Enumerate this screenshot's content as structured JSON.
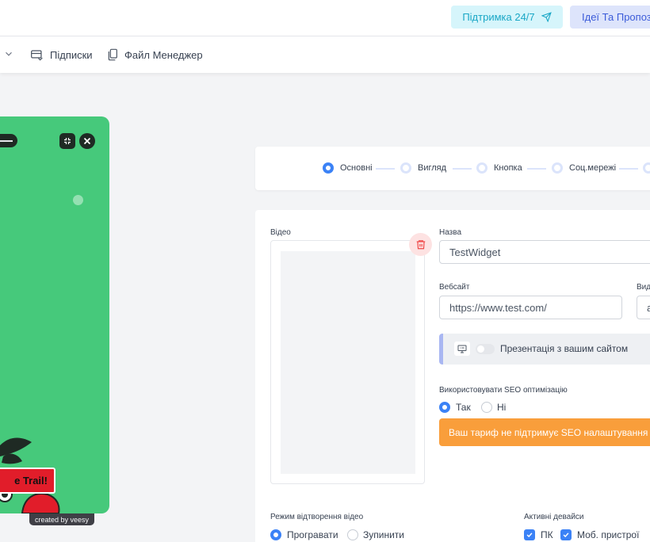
{
  "topbar": {
    "support_label": "Підтримка 24/7",
    "ideas_label": "Ідеї Та Пропози"
  },
  "nav": {
    "subscriptions_label": "Підписки",
    "file_manager_label": "Файл Менеджер"
  },
  "preview": {
    "cta_label": "e Trail!",
    "credit": "created by veesy"
  },
  "stepper": {
    "steps": [
      {
        "label": "Основні",
        "active": true
      },
      {
        "label": "Вигляд",
        "active": false
      },
      {
        "label": "Кнопка",
        "active": false
      },
      {
        "label": "Соц.мережі",
        "active": false
      }
    ]
  },
  "form": {
    "video_label": "Відео",
    "name_label": "Назва",
    "name_value": "TestWidget",
    "website_label": "Вебсайт",
    "website_value": "https://www.test.com/",
    "third_label": "Вид",
    "third_value": "a",
    "presentation_label": "Презентація з вашим сайтом",
    "seo_label": "Використовувати SEO оптимізацію",
    "seo_yes": "Так",
    "seo_no": "Ні",
    "seo_warning": "Ваш тариф не підтримує SEO налаштування",
    "playback_label": "Режим відтворення відео",
    "playback_play": "Програвати",
    "playback_stop": "Зупинити",
    "devices_label": "Активні девайси",
    "device_pc": "ПК",
    "device_mobile": "Моб. пристрої"
  },
  "colors": {
    "accent": "#3b82f6",
    "preview_bg": "#46c97b",
    "warning": "#f99e3b",
    "cta": "#e11d2a"
  }
}
